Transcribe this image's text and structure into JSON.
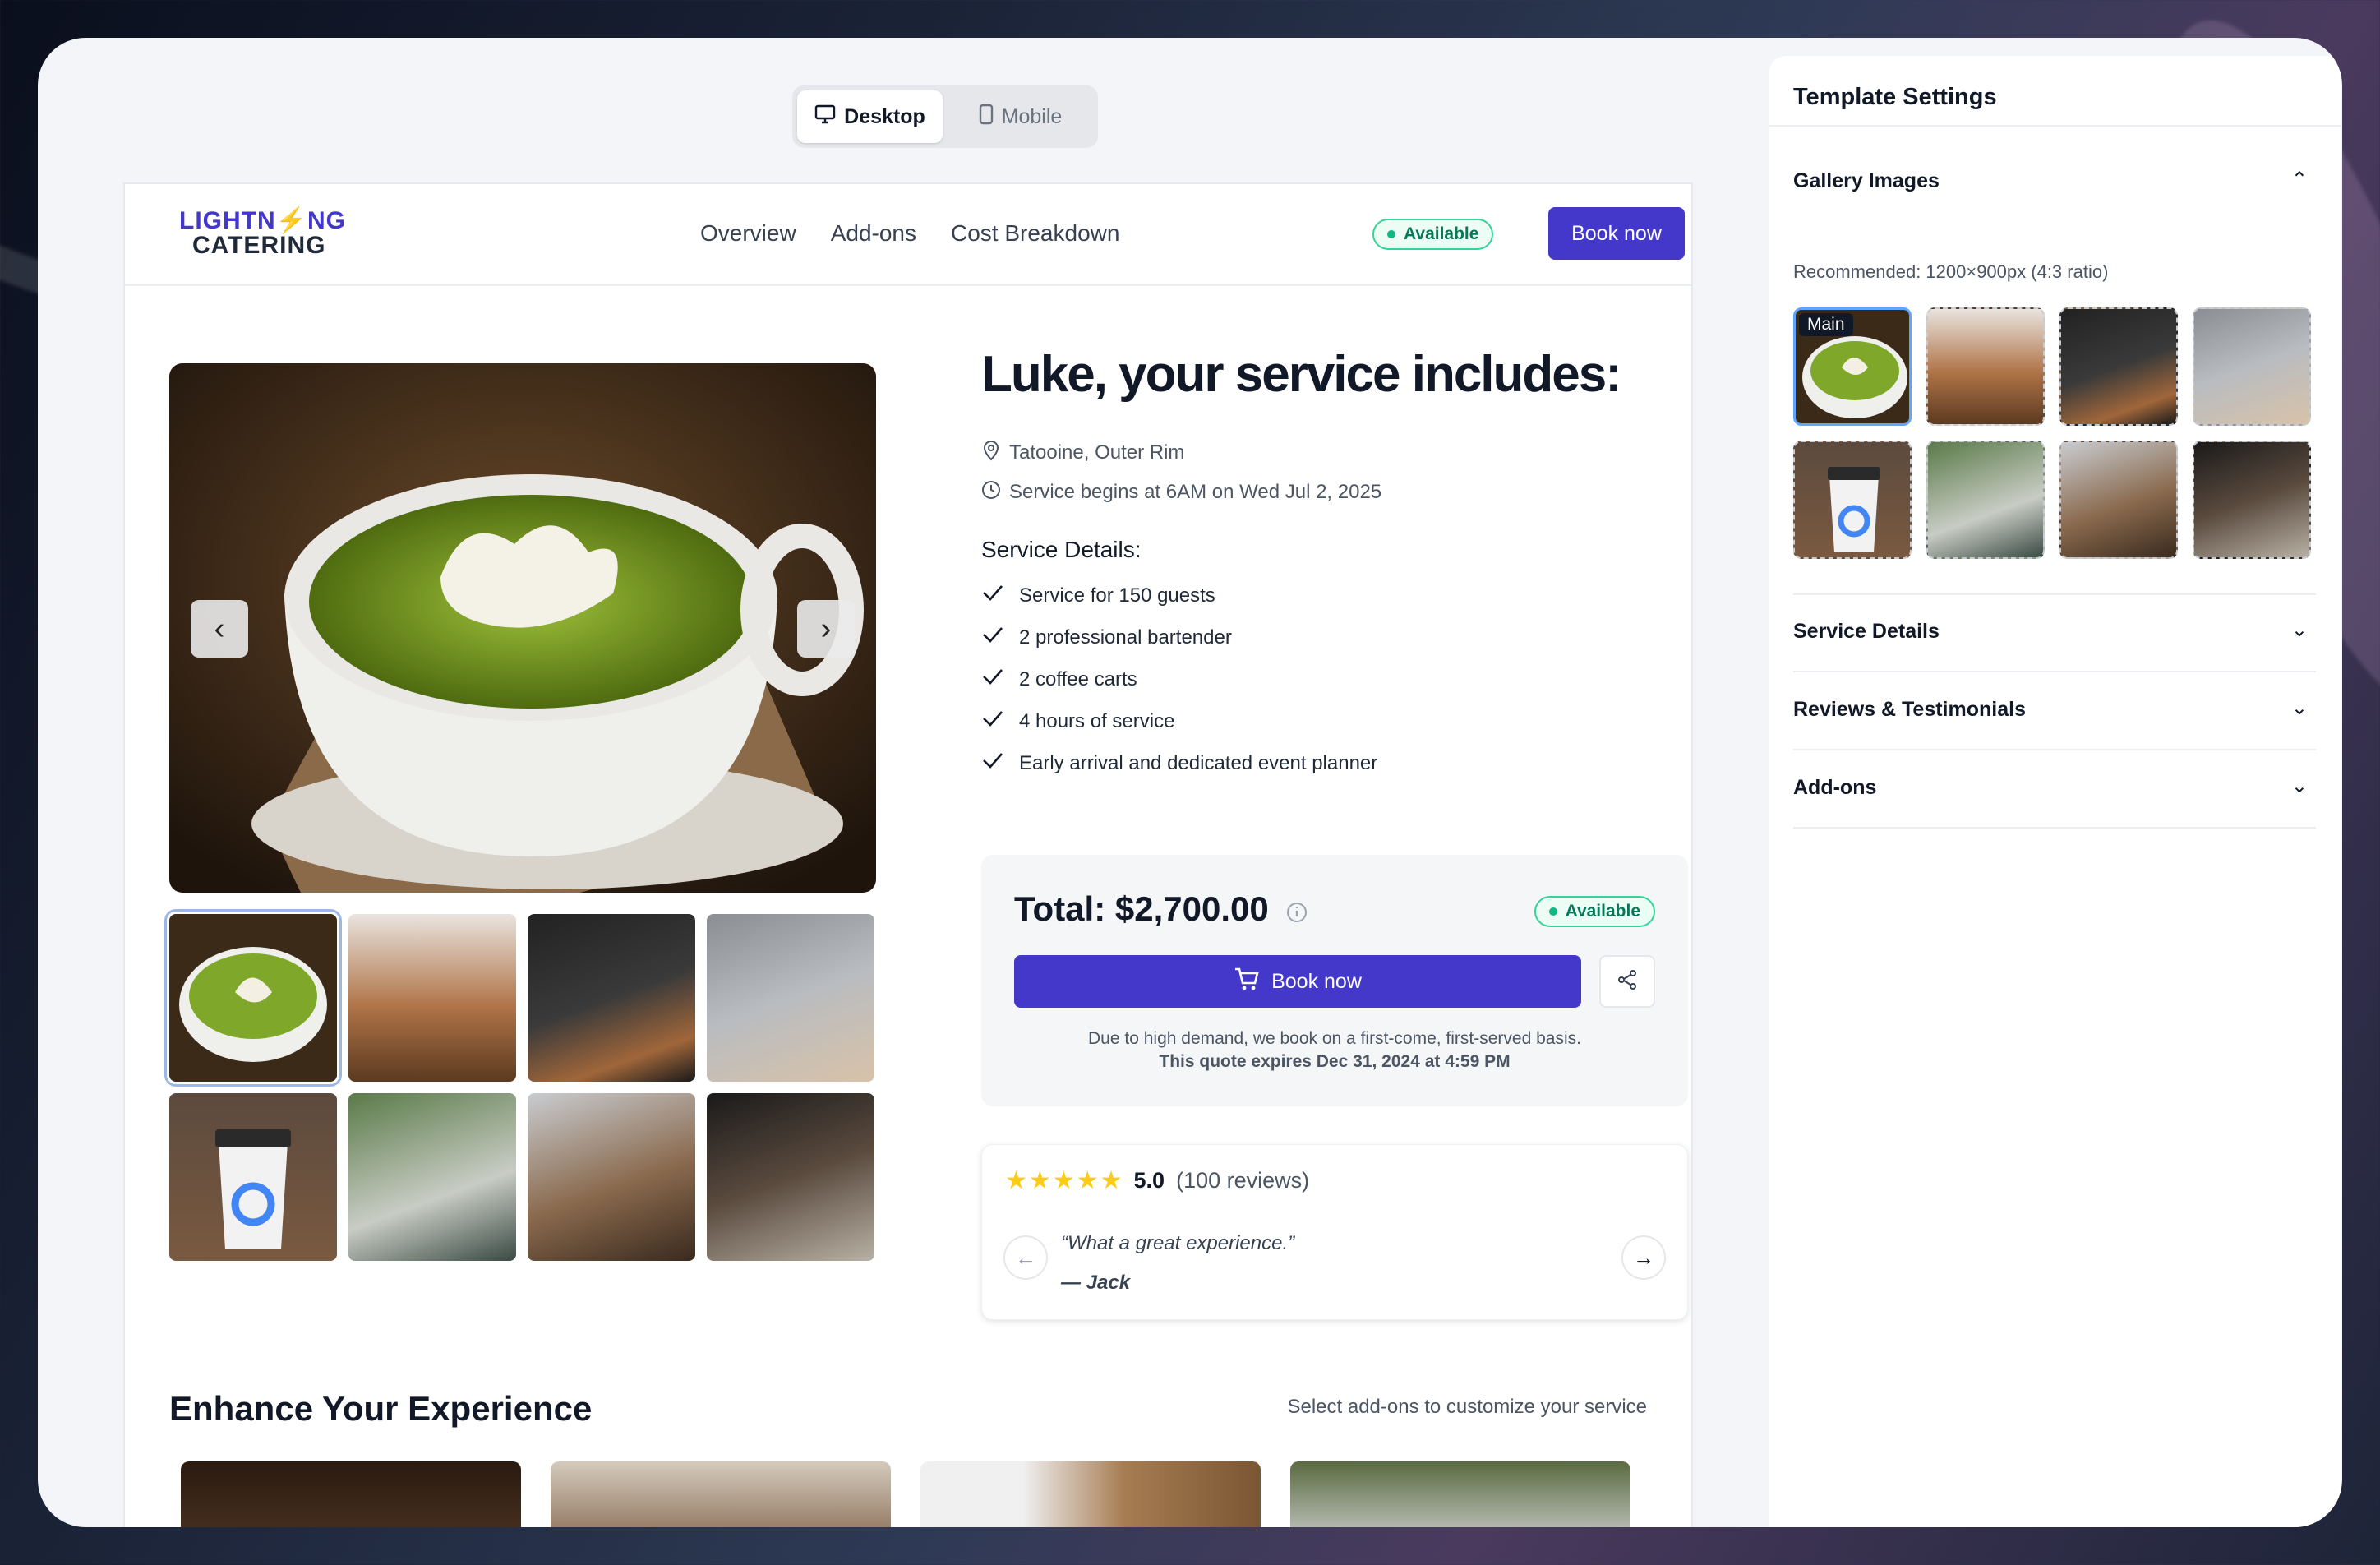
{
  "view_toggle": {
    "desktop": "Desktop",
    "mobile": "Mobile"
  },
  "preview": {
    "logo": {
      "line1": "LIGHTN⚡NG",
      "line2": "CATERING"
    },
    "nav_links": [
      "Overview",
      "Add-ons",
      "Cost Breakdown"
    ],
    "status": "Available",
    "book_now": "Book now",
    "heading": "Luke, your service includes:",
    "location": "Tatooine, Outer Rim",
    "start_time": "Service begins at 6AM on Wed Jul 2, 2025",
    "service_details_title": "Service Details:",
    "service_details": [
      "Service for 150 guests",
      "2 professional bartender",
      "2 coffee carts",
      "4 hours of service",
      "Early arrival and dedicated event planner"
    ],
    "total": "Total: $2,700.00",
    "book_now_cart": "Book now",
    "demand_note": "Due to high demand, we book on a first-come, first-served basis.",
    "expiry_note": "This quote expires Dec 31, 2024 at 4:59 PM",
    "rating": "5.0",
    "review_count": "(100 reviews)",
    "review_quote": "“What a great experience.”",
    "review_author": "— Jack",
    "enhance_title": "Enhance Your Experience",
    "enhance_subtitle": "Select add-ons to customize your service"
  },
  "settings": {
    "title": "Template Settings",
    "gallery_title": "Gallery Images",
    "recommended": "Recommended: 1200×900px (4:3 ratio)",
    "main_label": "Main",
    "sections": [
      "Service Details",
      "Reviews & Testimonials",
      "Add-ons"
    ]
  },
  "colors": {
    "accent": "#4338ca",
    "available": "#10b981",
    "star": "#facc15"
  }
}
